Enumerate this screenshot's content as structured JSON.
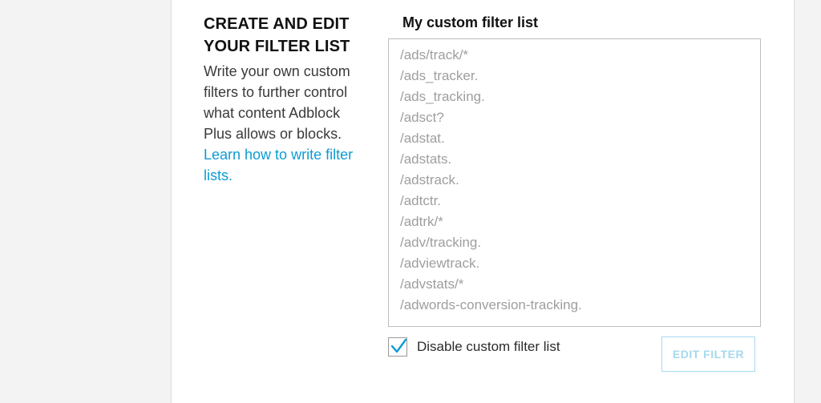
{
  "section": {
    "title": "CREATE AND EDIT YOUR FILTER LIST",
    "description": "Write your own custom filters  to further control what content Adblock Plus allows or blocks.",
    "learn_link": "Learn how to write filter lists."
  },
  "custom_list": {
    "label": "My custom filter list",
    "filters": [
      "/ads/track/*",
      "/ads_tracker.",
      "/ads_tracking.",
      "/adsct?",
      "/adstat.",
      "/adstats.",
      "/adstrack.",
      "/adtctr.",
      "/adtrk/*",
      "/adv/tracking.",
      "/adviewtrack.",
      "/advstats/*",
      "/adwords-conversion-tracking."
    ],
    "disable_label": "Disable custom filter list",
    "disable_checked": true,
    "edit_button_label": "EDIT FILTER"
  },
  "colors": {
    "accent": "#0d9bd3",
    "disabled_button": "#a6d9ee",
    "placeholder_text": "#9e9e9e"
  }
}
